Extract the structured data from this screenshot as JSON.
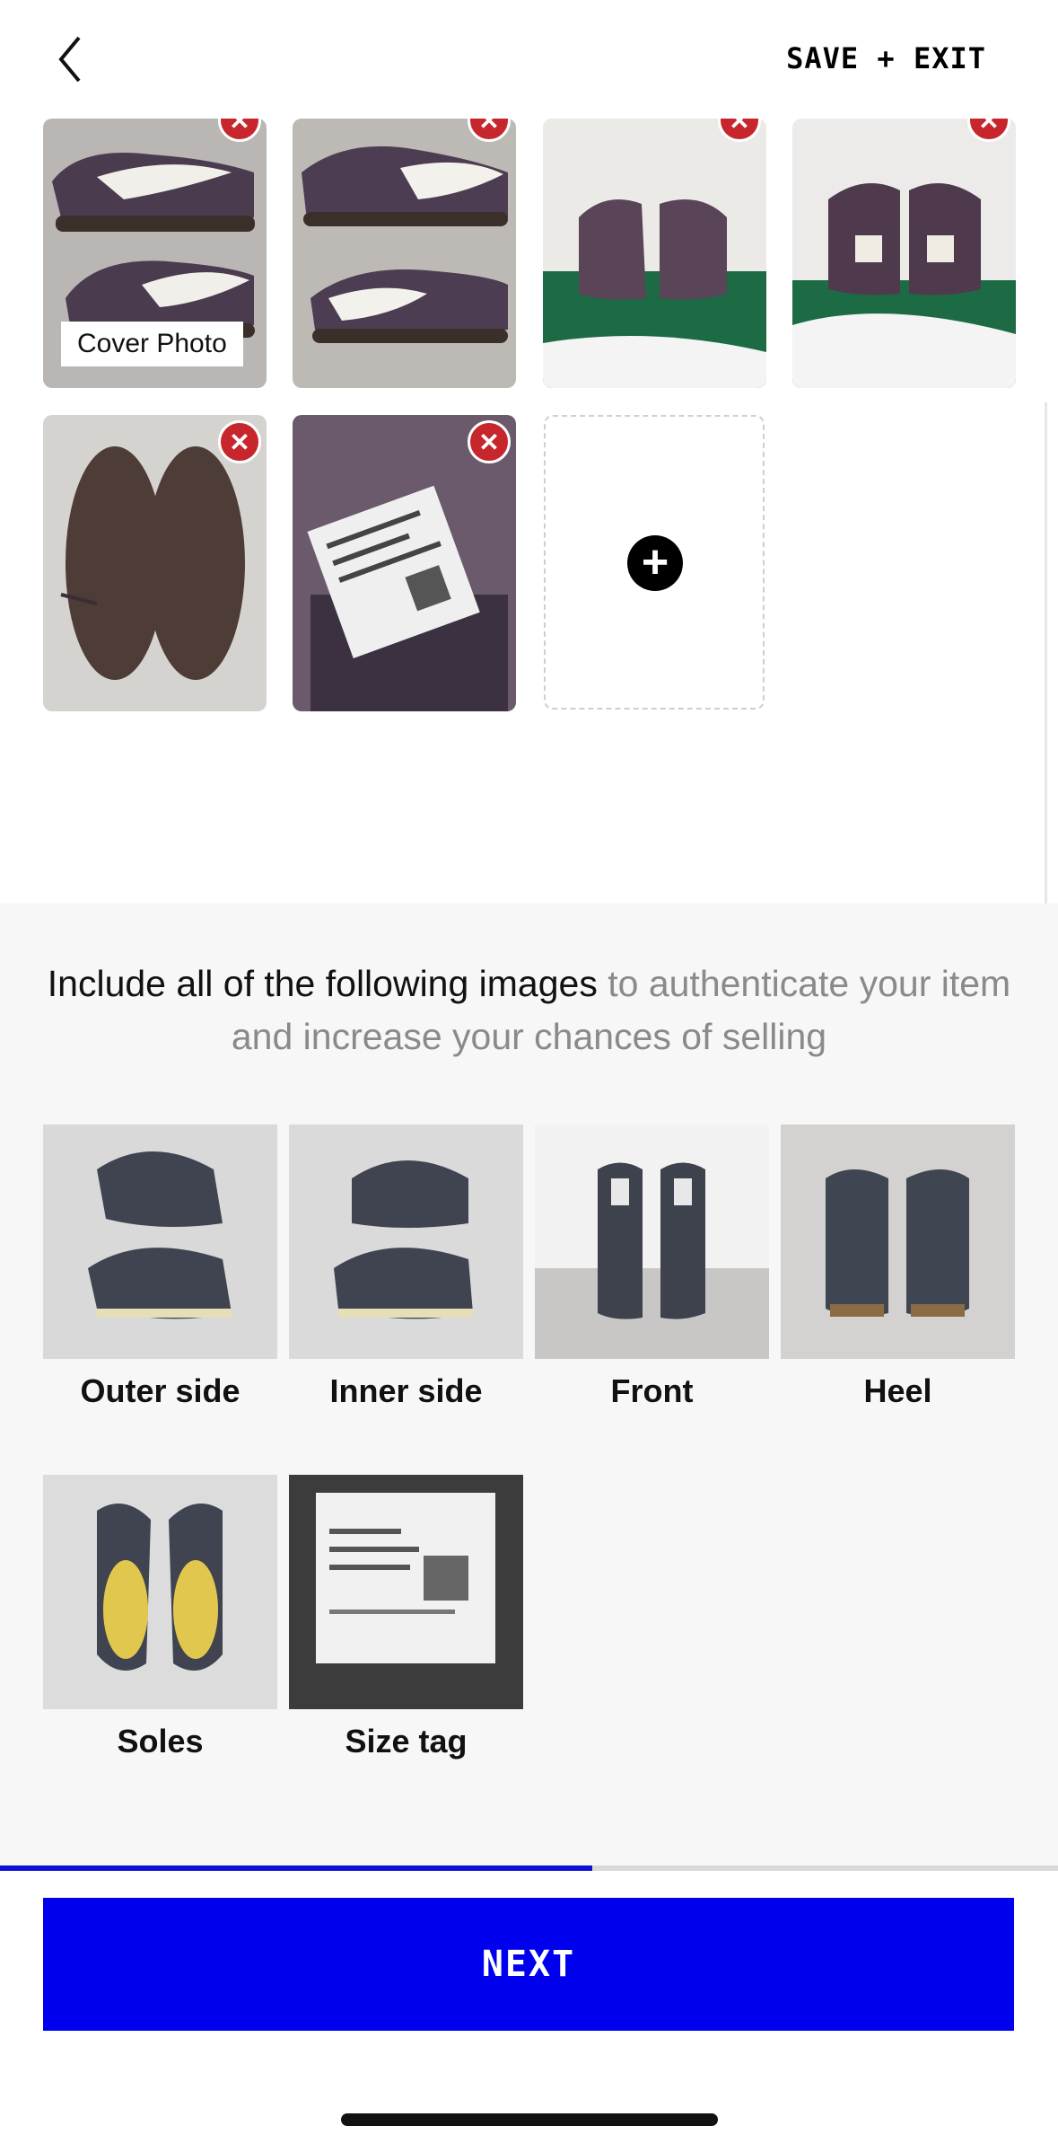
{
  "header": {
    "back_icon": "chevron-left-icon",
    "save_exit_label": "SAVE + EXIT"
  },
  "uploaded_photos": {
    "cover_label": "Cover Photo",
    "remove_icon": "close-icon",
    "add_icon": "plus-circle-icon",
    "count": 6
  },
  "guide": {
    "intro_dark": "Include all of the following images",
    "intro_muted": " to authenticate your item and increase your chances of selling",
    "items": [
      {
        "label": "Outer side"
      },
      {
        "label": "Inner side"
      },
      {
        "label": "Front"
      },
      {
        "label": "Heel"
      },
      {
        "label": "Soles"
      },
      {
        "label": "Size tag"
      }
    ]
  },
  "progress": {
    "fraction": 0.56
  },
  "footer": {
    "next_label": "NEXT"
  },
  "colors": {
    "accent": "#0000ee",
    "remove": "#c7262d"
  }
}
